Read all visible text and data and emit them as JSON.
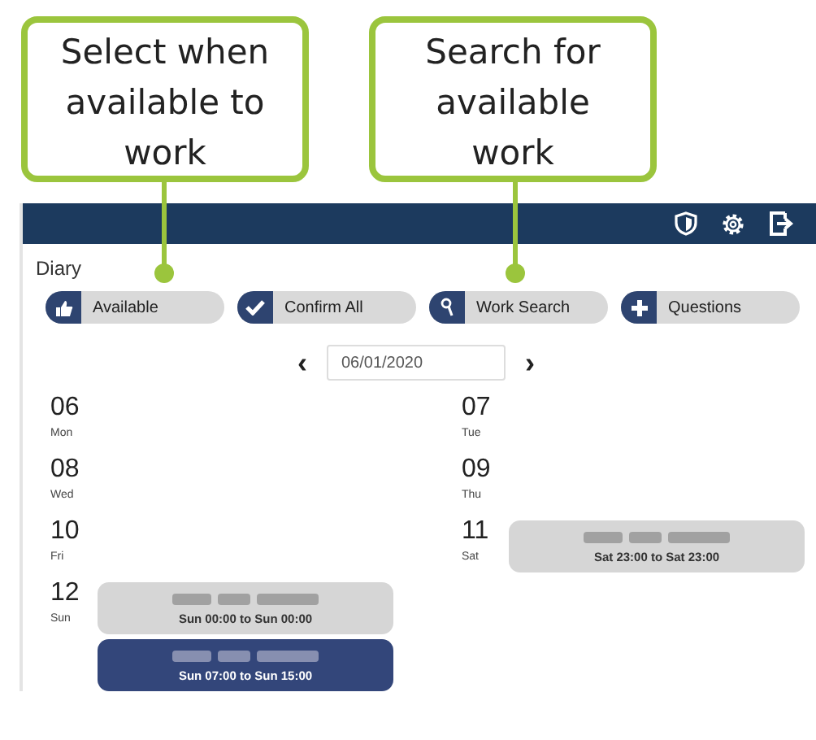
{
  "callouts": [
    {
      "text": "Select when available to work"
    },
    {
      "text": "Search for available work"
    }
  ],
  "page_title": "Diary",
  "actions": [
    {
      "label": "Available"
    },
    {
      "label": "Confirm All"
    },
    {
      "label": "Work Search"
    },
    {
      "label": "Questions"
    }
  ],
  "date_nav": {
    "prev": "‹",
    "date": "06/01/2020",
    "next": "›"
  },
  "days": [
    {
      "num": "06",
      "name": "Mon"
    },
    {
      "num": "07",
      "name": "Tue"
    },
    {
      "num": "08",
      "name": "Wed"
    },
    {
      "num": "09",
      "name": "Thu"
    },
    {
      "num": "10",
      "name": "Fri"
    },
    {
      "num": "11",
      "name": "Sat",
      "events": [
        {
          "kind": "pending",
          "time": "Sat 23:00 to Sat 23:00"
        }
      ]
    },
    {
      "num": "12",
      "name": "Sun",
      "events": [
        {
          "kind": "pending",
          "time": "Sun 00:00 to Sun 00:00"
        },
        {
          "kind": "booked",
          "time": "Sun 07:00 to Sun 15:00"
        }
      ]
    }
  ]
}
